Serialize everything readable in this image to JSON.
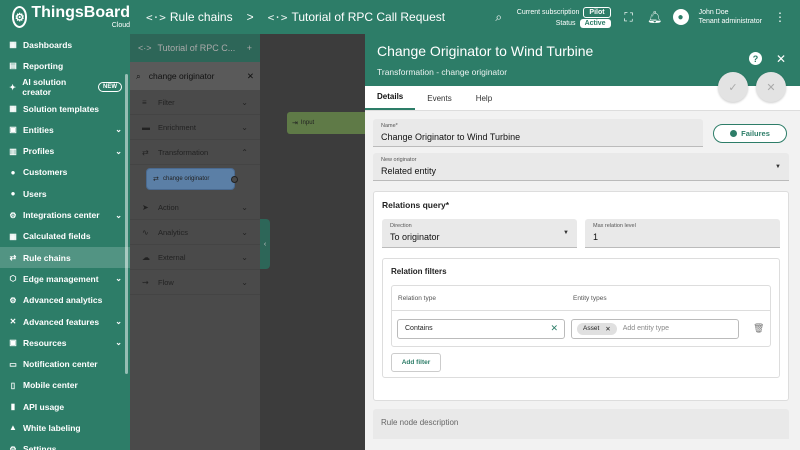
{
  "app": {
    "name": "ThingsBoard",
    "sub": "Cloud"
  },
  "breadcrumb": {
    "first": "Rule chains",
    "separator": ">",
    "current": "Tutorial of RPC Call Request"
  },
  "topbar": {
    "subscription_label": "Current subscription",
    "subscription_value": "Pilot",
    "status_label": "Status",
    "status_value": "Active",
    "user_name": "John Doe",
    "user_role": "Tenant administrator"
  },
  "sidebar": {
    "items": [
      {
        "label": "Dashboards",
        "icon": "dashboard-icon"
      },
      {
        "label": "Reporting",
        "icon": "report-icon"
      },
      {
        "label": "AI solution creator",
        "icon": "ai-icon",
        "badge": "NEW"
      },
      {
        "label": "Solution templates",
        "icon": "grid-icon"
      },
      {
        "label": "Entities",
        "icon": "entities-icon",
        "chevron": true
      },
      {
        "label": "Profiles",
        "icon": "profile-icon",
        "chevron": true
      },
      {
        "label": "Customers",
        "icon": "customers-icon"
      },
      {
        "label": "Users",
        "icon": "users-icon"
      },
      {
        "label": "Integrations center",
        "icon": "integrations-icon",
        "chevron": true
      },
      {
        "label": "Calculated fields",
        "icon": "calc-icon"
      },
      {
        "label": "Rule chains",
        "icon": "rule-chains-icon",
        "active": true
      },
      {
        "label": "Edge management",
        "icon": "edge-icon",
        "chevron": true
      },
      {
        "label": "Advanced analytics",
        "icon": "analytics-icon"
      },
      {
        "label": "Advanced features",
        "icon": "features-icon",
        "chevron": true
      },
      {
        "label": "Resources",
        "icon": "resources-icon",
        "chevron": true
      },
      {
        "label": "Notification center",
        "icon": "notification-icon"
      },
      {
        "label": "Mobile center",
        "icon": "mobile-icon"
      },
      {
        "label": "API usage",
        "icon": "api-icon"
      },
      {
        "label": "White labeling",
        "icon": "label-icon"
      },
      {
        "label": "Settings",
        "icon": "settings-icon"
      }
    ]
  },
  "library": {
    "header": "Tutorial of RPC C...",
    "search_value": "change originator",
    "categories": [
      {
        "label": "Filter",
        "open": false
      },
      {
        "label": "Enrichment",
        "open": false
      },
      {
        "label": "Transformation",
        "open": true
      },
      {
        "label": "Action",
        "open": false
      },
      {
        "label": "Analytics",
        "open": false
      },
      {
        "label": "External",
        "open": false
      },
      {
        "label": "Flow",
        "open": false
      }
    ],
    "node_label": "change originator"
  },
  "canvas": {
    "input_node_label": "Input"
  },
  "panel": {
    "title": "Change Originator to Wind Turbine",
    "subtitle": "Transformation - change originator",
    "tabs": [
      "Details",
      "Events",
      "Help"
    ],
    "name_label": "Name*",
    "name_value": "Change Originator to Wind Turbine",
    "failures_label": "Failures",
    "originator_label": "New originator",
    "originator_value": "Related entity",
    "relations_query_title": "Relations query*",
    "direction_label": "Direction",
    "direction_value": "To originator",
    "max_level_label": "Max relation level",
    "max_level_value": "1",
    "relation_filters_title": "Relation filters",
    "col_relation_type": "Relation type",
    "col_entity_types": "Entity types",
    "relation_type_value": "Contains",
    "entity_chip": "Asset",
    "entity_placeholder": "Add entity type",
    "add_filter_label": "Add filter",
    "description_placeholder": "Rule node description"
  }
}
